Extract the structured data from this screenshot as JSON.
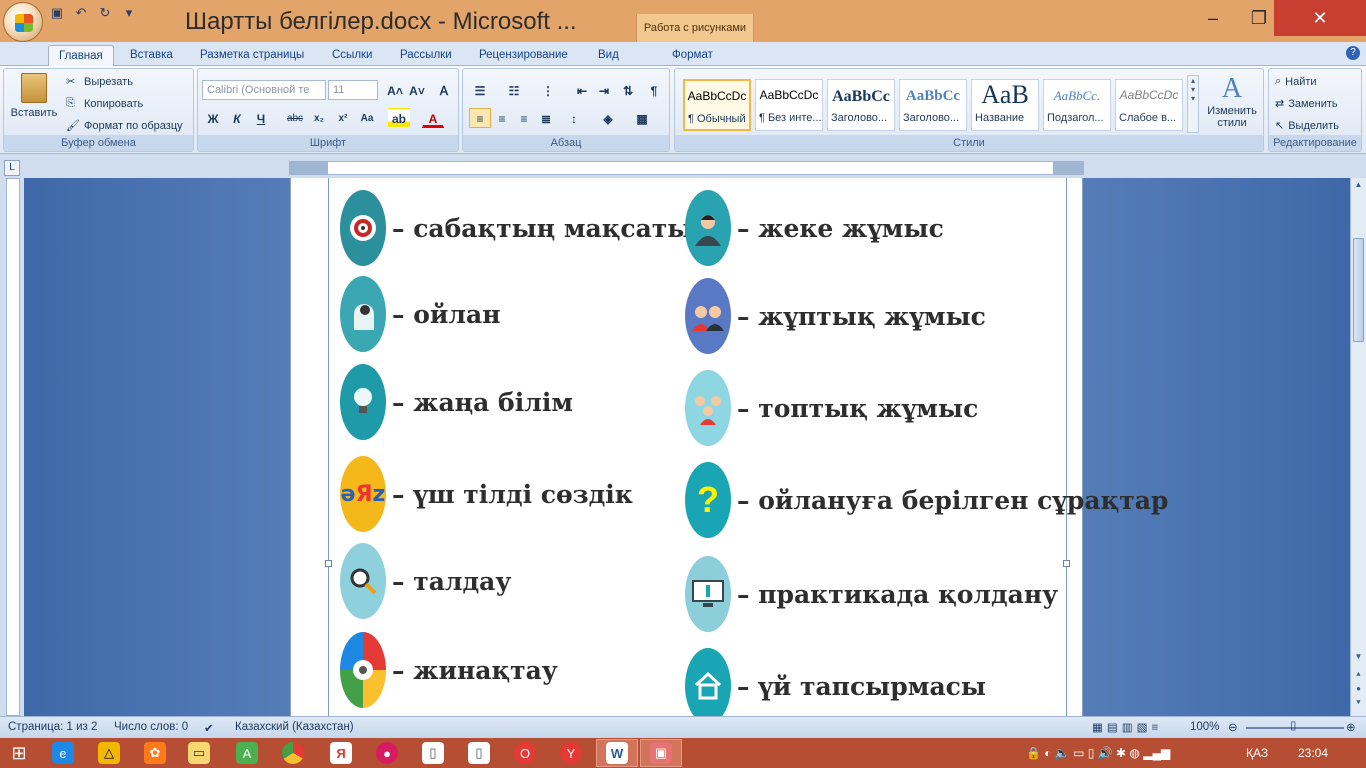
{
  "window": {
    "title": "Шартты белгілер.docx - Microsoft ...",
    "context_tab_title": "Работа с рисунками"
  },
  "tabs": [
    "Главная",
    "Вставка",
    "Разметка страницы",
    "Ссылки",
    "Рассылки",
    "Рецензирование",
    "Вид",
    "Формат"
  ],
  "active_tab": "Главная",
  "clipboard": {
    "paste": "Вставить",
    "cut": "Вырезать",
    "copy": "Копировать",
    "format_painter": "Формат по образцу",
    "label": "Буфер обмена"
  },
  "font": {
    "name": "Calibri (Основной те",
    "size": "11",
    "label": "Шрифт"
  },
  "paragraph": {
    "label": "Абзац"
  },
  "styles": {
    "items": [
      {
        "sample": "AaBbCcDc",
        "name": "¶ Обычный"
      },
      {
        "sample": "AaBbCcDc",
        "name": "¶ Без инте..."
      },
      {
        "sample": "AaBbCc",
        "name": "Заголово..."
      },
      {
        "sample": "AaBbCc",
        "name": "Заголово..."
      },
      {
        "sample": "AaB",
        "name": "Название"
      },
      {
        "sample": "AaBbCc.",
        "name": "Подзагол..."
      },
      {
        "sample": "AaBbCcDc",
        "name": "Слабое в..."
      }
    ],
    "change": "Изменить стили",
    "label": "Стили"
  },
  "editing": {
    "find": "Найти",
    "replace": "Заменить",
    "select": "Выделить",
    "label": "Редактирование"
  },
  "document": {
    "left": [
      {
        "icon": "target-icon",
        "text": "– сабақтың мақсаты"
      },
      {
        "icon": "head-gear-icon",
        "text": "– ойлан"
      },
      {
        "icon": "lightbulb-icon",
        "text": "– жаңа білім"
      },
      {
        "icon": "abc-letters-icon",
        "text": "– үш тілді сөздік"
      },
      {
        "icon": "magnifier-icon",
        "text": "– талдау"
      },
      {
        "icon": "gears-icon",
        "text": "– жинақтау"
      }
    ],
    "right": [
      {
        "icon": "person-icon",
        "text": "– жеке жұмыс"
      },
      {
        "icon": "pair-icon",
        "text": "– жұптық жұмыс"
      },
      {
        "icon": "group-icon",
        "text": "– топтық жұмыс"
      },
      {
        "icon": "question-icon",
        "text": "– ойлануға берілген сұрақтар"
      },
      {
        "icon": "info-monitor-icon",
        "text": "– практикада қолдану"
      },
      {
        "icon": "house-icon",
        "text": "– үй тапсырмасы"
      }
    ]
  },
  "status": {
    "page": "Страница: 1 из 2",
    "words": "Число слов: 0",
    "language": "Казахский (Казахстан)",
    "zoom": "100%"
  },
  "tray": {
    "lang": "ҚАЗ",
    "time": "23:04"
  }
}
